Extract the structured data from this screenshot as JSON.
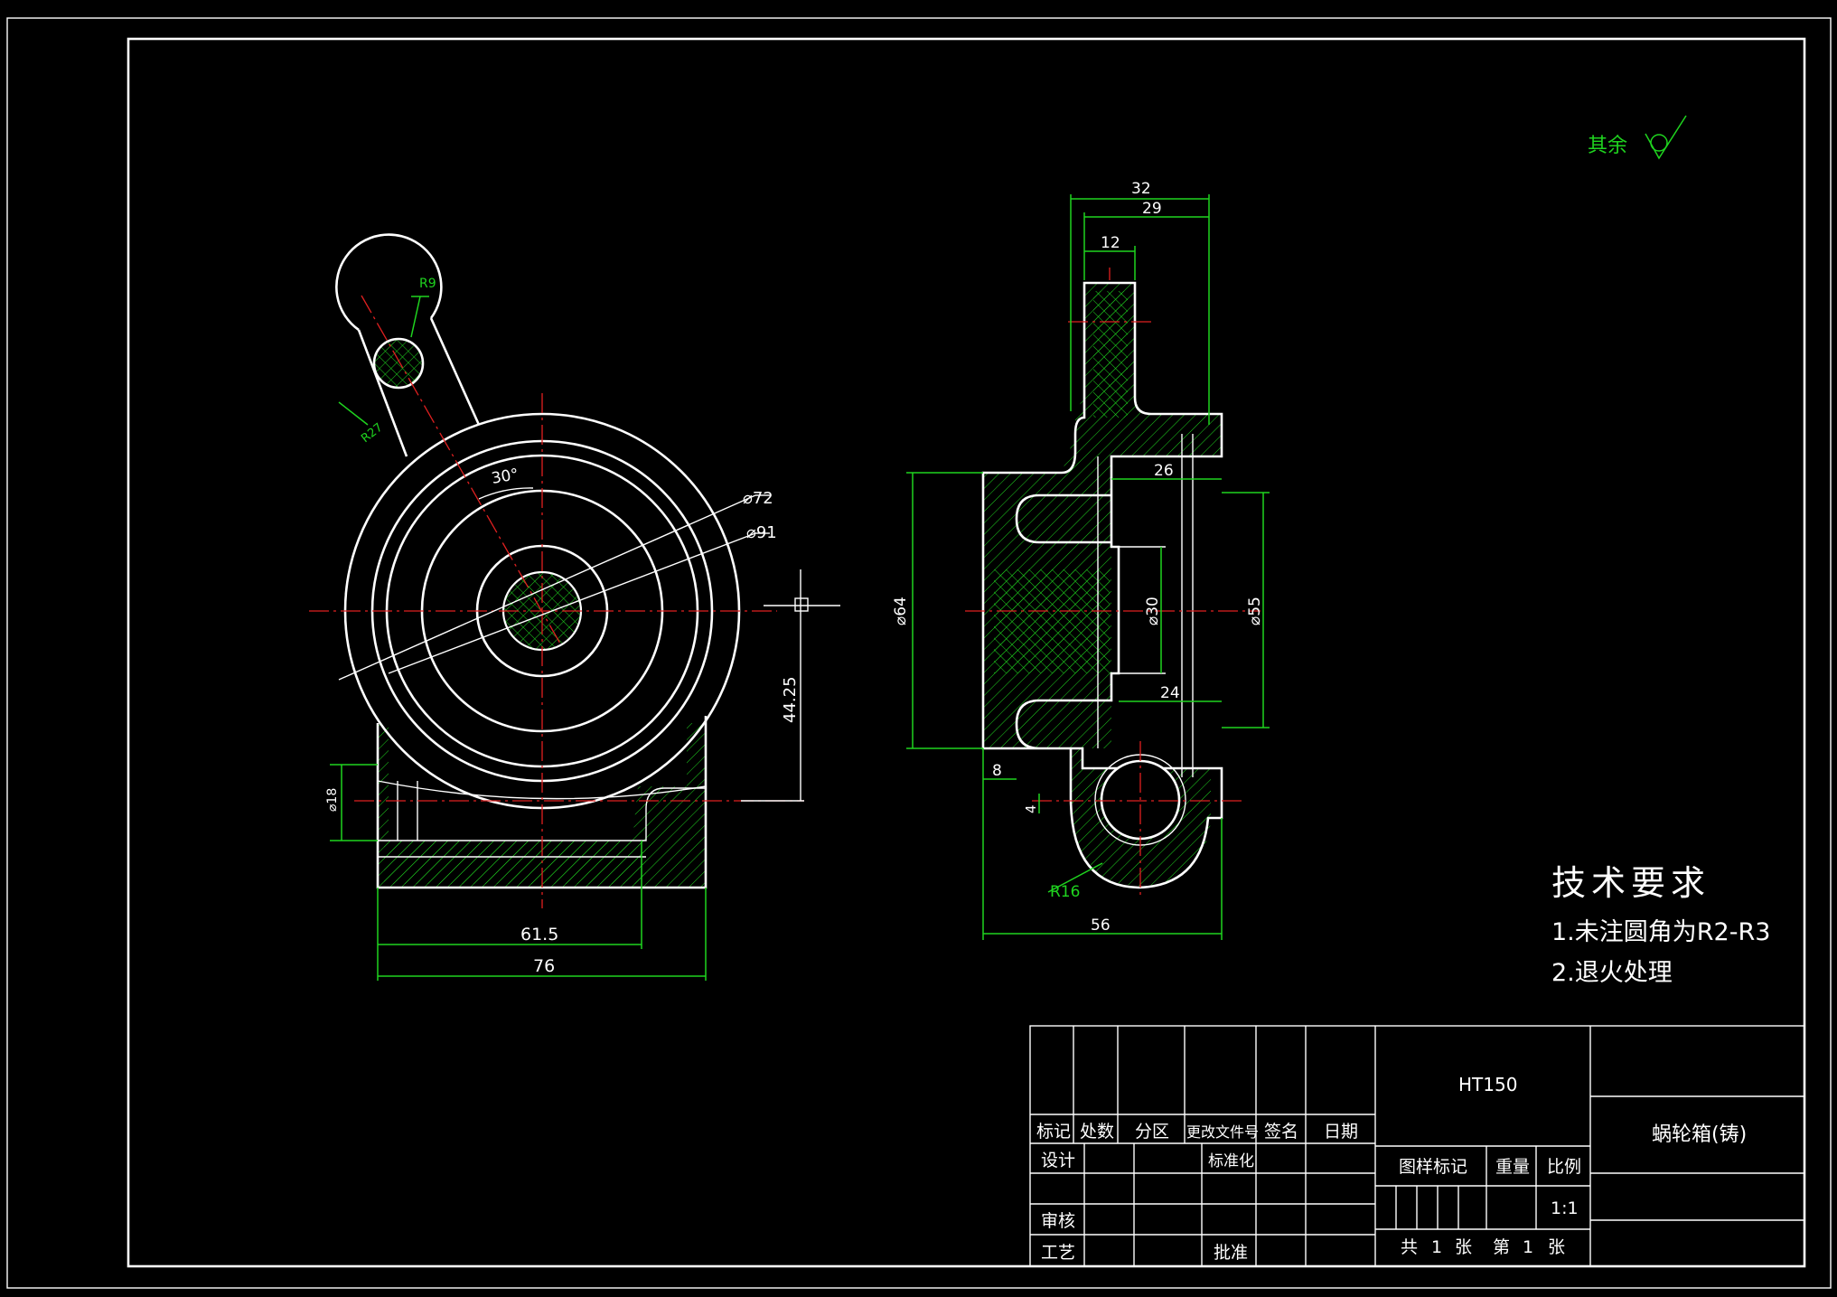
{
  "surface_symbol": {
    "label": "其余"
  },
  "tech_req": {
    "title": "技术要求",
    "items": [
      "1.未注圆角为R2-R3",
      "2.退火处理"
    ]
  },
  "dims_front": {
    "r9": "R9",
    "r27": "R27",
    "angle": "30°",
    "d72": "⌀72",
    "d91": "⌀91",
    "h44": "44.25",
    "d18": "⌀18",
    "w615": "61.5",
    "w76": "76"
  },
  "dims_side": {
    "w32": "32",
    "w29": "29",
    "w12": "12",
    "w26": "26",
    "d64": "⌀64",
    "d30": "⌀30",
    "d55": "⌀55",
    "w24": "24",
    "w8": "8",
    "h4": "4",
    "r16": "R16",
    "w56": "56"
  },
  "title_block": {
    "material": "HT150",
    "part_name": "蜗轮箱(铸)",
    "rev_headers": [
      "标记",
      "处数",
      "分区",
      "更改文件号",
      "签名",
      "日期"
    ],
    "design": "设计",
    "standardize": "标准化",
    "review": "审核",
    "process": "工艺",
    "approve": "批准",
    "stage_mark": "图样标记",
    "weight": "重量",
    "scale_label": "比例",
    "scale_value": "1:1",
    "sheets_total_label": "共",
    "sheets_total": "1",
    "sheet_unit": "张",
    "sheet_no_label": "第",
    "sheet_no": "1"
  }
}
